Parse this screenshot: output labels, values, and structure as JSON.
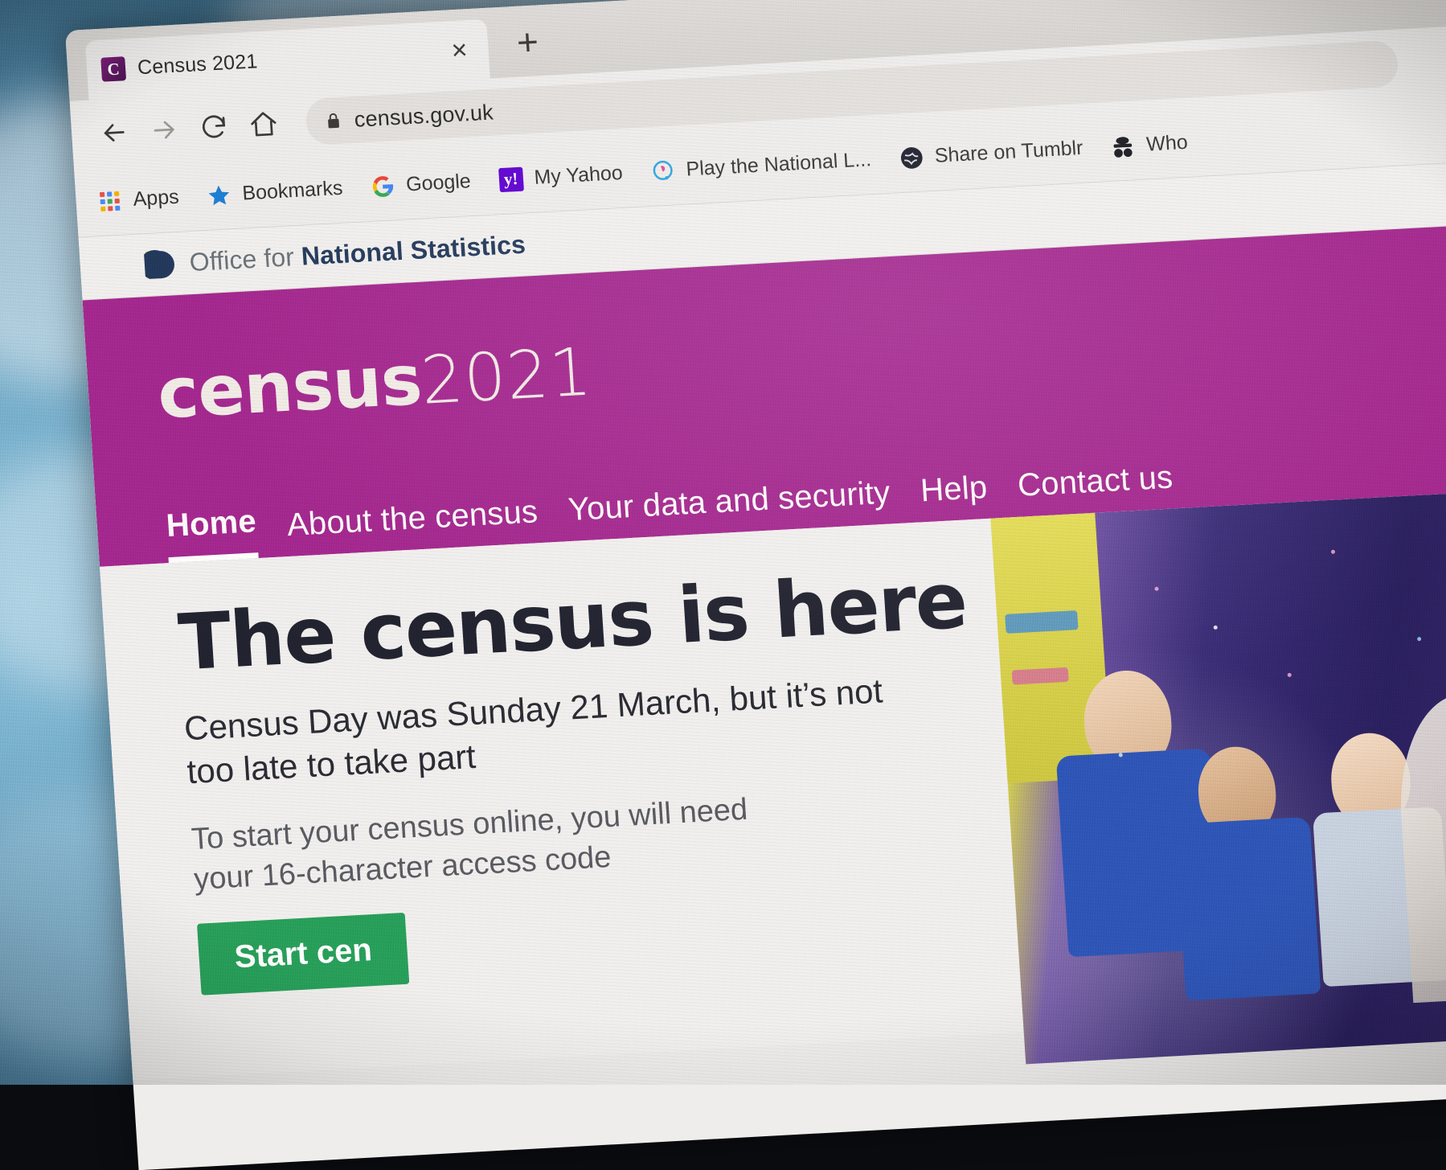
{
  "browser": {
    "tab": {
      "title": "Census 2021",
      "favicon_letter": "C",
      "close_label": "×"
    },
    "new_tab_label": "+",
    "url": "census.gov.uk",
    "nav_icons": [
      "back-arrow-icon",
      "forward-arrow-icon",
      "reload-icon",
      "home-icon"
    ],
    "bookmarks": [
      {
        "label": "Apps",
        "icon": "apps-grid-icon"
      },
      {
        "label": "Bookmarks",
        "icon": "star-icon"
      },
      {
        "label": "Google",
        "icon": "google-g-icon"
      },
      {
        "label": "My Yahoo",
        "icon": "yahoo-icon"
      },
      {
        "label": "Play the National L...",
        "icon": "national-lottery-icon"
      },
      {
        "label": "Share on Tumblr",
        "icon": "tumblr-globe-icon"
      },
      {
        "label": "Who",
        "icon": "who-icon"
      }
    ]
  },
  "site": {
    "ons_logo": {
      "light_text": "Office for ",
      "dark_text": "National Statistics"
    },
    "wordmark": {
      "name": "census",
      "year": "2021"
    },
    "nav": [
      {
        "label": "Home",
        "active": true
      },
      {
        "label": "About the census",
        "active": false
      },
      {
        "label": "Your data and security",
        "active": false
      },
      {
        "label": "Help",
        "active": false
      },
      {
        "label": "Contact us",
        "active": false
      }
    ],
    "hero": {
      "heading": "The census is here",
      "lede": "Census Day was Sunday 21 March, but it’s not too late to take part",
      "body": "To start your census online, you will need your 16-character access code",
      "button": "Start cen",
      "image_alt": "children-in-blue-aprons-photo"
    }
  },
  "colors": {
    "census_magenta": "#a5288f",
    "ons_navy": "#23395c",
    "ons_yellow": "#c8d400",
    "start_green": "#28a05a",
    "page_background": "#f2f0ee",
    "chrome_background": "#efedeb"
  }
}
